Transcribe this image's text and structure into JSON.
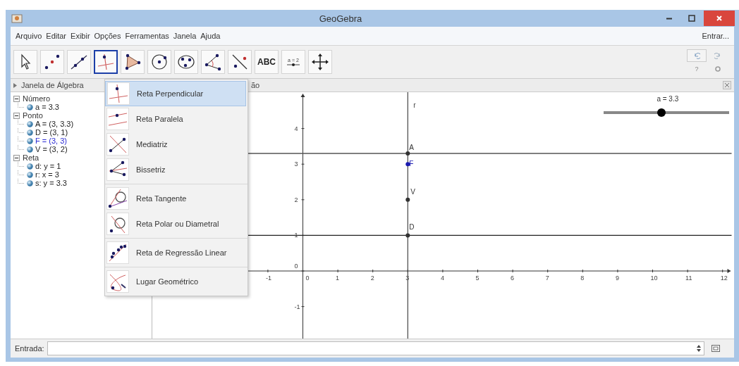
{
  "window": {
    "title": "GeoGebra"
  },
  "menubar": {
    "items": [
      "Arquivo",
      "Editar",
      "Exibir",
      "Opções",
      "Ferramentas",
      "Janela",
      "Ajuda"
    ],
    "login": "Entrar..."
  },
  "toolbar": {
    "tools": [
      {
        "kind": "move",
        "selected": false
      },
      {
        "kind": "point",
        "selected": false
      },
      {
        "kind": "line",
        "selected": false
      },
      {
        "kind": "perpendicular",
        "selected": true
      },
      {
        "kind": "polygon",
        "selected": false
      },
      {
        "kind": "circle",
        "selected": false
      },
      {
        "kind": "conic",
        "selected": false
      },
      {
        "kind": "angle",
        "selected": false
      },
      {
        "kind": "reflect",
        "selected": false
      },
      {
        "kind": "text",
        "selected": false,
        "label": "ABC"
      },
      {
        "kind": "slider",
        "selected": false,
        "label": "a = 2"
      },
      {
        "kind": "pan",
        "selected": false
      }
    ],
    "help": "?"
  },
  "algebra_view": {
    "title": "Janela de Álgebra",
    "children": [
      {
        "label": "Número",
        "expanded": true,
        "children": [
          {
            "label": "a = 3.3",
            "color": "#222222"
          }
        ]
      },
      {
        "label": "Ponto",
        "expanded": true,
        "children": [
          {
            "label": "A = (3, 3.3)",
            "color": "#222222"
          },
          {
            "label": "D = (3, 1)",
            "color": "#222222"
          },
          {
            "label": "F = (3, 3)",
            "color": "#2b2bd4"
          },
          {
            "label": "V = (3, 2)",
            "color": "#222222"
          }
        ]
      },
      {
        "label": "Reta",
        "expanded": true,
        "children": [
          {
            "label": "d: y = 1",
            "color": "#222222"
          },
          {
            "label": "r: x = 3",
            "color": "#222222"
          },
          {
            "label": "s: y = 3.3",
            "color": "#222222"
          }
        ]
      }
    ]
  },
  "graphics_view": {
    "title": "ão",
    "x_tick_labels": [
      "-1",
      "0",
      "1",
      "2",
      "3",
      "4",
      "5",
      "6",
      "7",
      "8",
      "9",
      "10",
      "11",
      "12"
    ],
    "y_tick_labels": [
      "4",
      "3",
      "2",
      "1",
      "0",
      "-1"
    ],
    "line_label": "r",
    "points": [
      {
        "label": "A",
        "color": "#333333"
      },
      {
        "label": "F",
        "color": "#1a1ab0"
      },
      {
        "label": "V",
        "color": "#333333"
      },
      {
        "label": "D",
        "color": "#333333"
      }
    ],
    "slider": {
      "label": "a = 3.3",
      "level": 0.46
    }
  },
  "tool_menu": {
    "groups": [
      {
        "items": [
          {
            "kind": "perpendicular",
            "label": "Reta Perpendicular",
            "selected": true
          },
          {
            "kind": "parallel",
            "label": "Reta Paralela",
            "selected": false
          },
          {
            "kind": "mediatrix",
            "label": "Mediatriz",
            "selected": false
          },
          {
            "kind": "bisector",
            "label": "Bissetriz",
            "selected": false
          }
        ]
      },
      {
        "items": [
          {
            "kind": "tangent",
            "label": "Reta Tangente",
            "selected": false
          },
          {
            "kind": "polar",
            "label": "Reta Polar ou Diametral",
            "selected": false
          }
        ]
      },
      {
        "items": [
          {
            "kind": "regression",
            "label": "Reta de Regressão Linear",
            "selected": false
          }
        ]
      },
      {
        "items": [
          {
            "kind": "locus",
            "label": "Lugar Geométrico",
            "selected": false
          }
        ]
      }
    ]
  },
  "input_bar": {
    "label": "Entrada:"
  }
}
